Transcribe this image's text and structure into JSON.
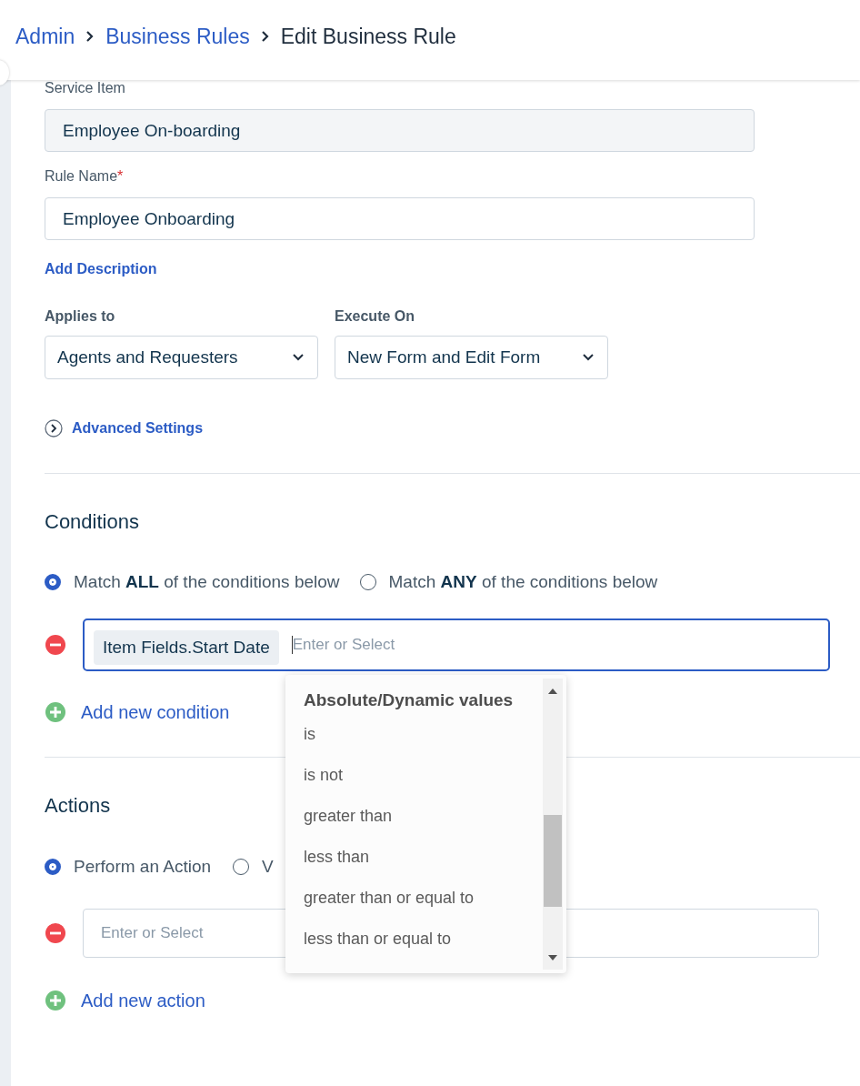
{
  "breadcrumb": [
    {
      "label": "Admin",
      "kind": "link"
    },
    {
      "label": "Business Rules",
      "kind": "link"
    },
    {
      "label": "Edit Business Rule",
      "kind": "current"
    }
  ],
  "service_item": {
    "label": "Service Item",
    "value": "Employee On-boarding",
    "disabled": true
  },
  "rule_name": {
    "label": "Rule Name",
    "required": true,
    "required_mark": "*",
    "value": "Employee Onboarding",
    "disabled": false
  },
  "add_description": "Add Description",
  "applies_to": {
    "label": "Applies to",
    "value": "Agents and Requesters"
  },
  "execute_on": {
    "label": "Execute On",
    "value": "New Form and Edit Form"
  },
  "advanced_settings": {
    "label": "Advanced Settings",
    "expanded": false
  },
  "conditions": {
    "title": "Conditions",
    "match_options": [
      {
        "label": "Match **ALL** of the conditions below",
        "selected": true
      },
      {
        "label": "Match **ANY** of the conditions below",
        "selected": false
      }
    ],
    "rows": [
      {
        "tag": "Item Fields.Start Date",
        "placeholder": "Enter or Select",
        "focused": true
      }
    ],
    "add_label": "Add new condition"
  },
  "operator_dropdown": {
    "group": "Absolute/Dynamic values",
    "options": [
      "is",
      "is not",
      "greater than",
      "less than",
      "greater than or equal to",
      "less than or equal to"
    ]
  },
  "actions": {
    "title": "Actions",
    "options": [
      {
        "label": "Perform an Action",
        "selected": true
      },
      {
        "label": "V",
        "selected": false
      }
    ],
    "rows": [
      {
        "placeholder": "Enter or Select",
        "focused": false
      }
    ],
    "add_label": "Add new action"
  }
}
